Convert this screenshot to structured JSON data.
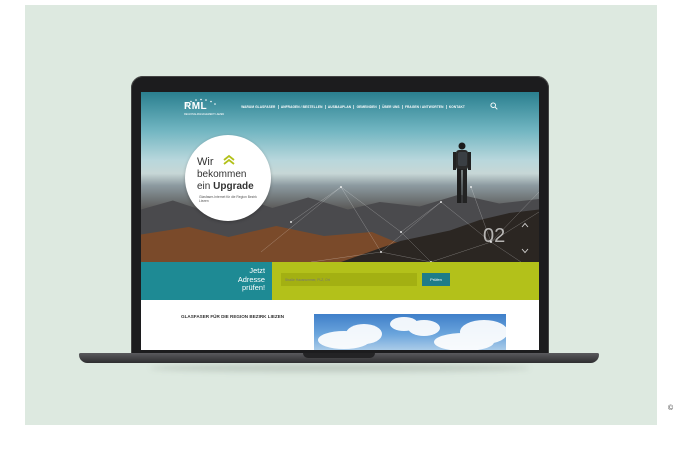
{
  "nav": {
    "logo_text": "RML",
    "logo_sub": "REGIONALMANAGEMENT LIEZEN",
    "items": [
      "WARUM GLASFASER",
      "ANFRAGEN / BESTELLEN",
      "AUSBAUPLAN",
      "GEMEINDEN",
      "ÜBER UNS",
      "FRAGEN / ANTWORTEN",
      "KONTAKT"
    ]
  },
  "hero": {
    "headline_line1": "Wir",
    "headline_line2": "bekommen",
    "headline_line3_prefix": "ein",
    "headline_line3_bold": "Upgrade",
    "subline": "Glasfaser-Internet für die Region Bezirk Liezen",
    "slide_counter": "02"
  },
  "address_check": {
    "label_line1": "Jetzt",
    "label_line2": "Adresse",
    "label_line3": "prüfen!",
    "input_placeholder": "Straße Hausnummer, PLZ, Ort",
    "button_label": "Prüfen"
  },
  "content": {
    "title": "GLASFASER FÜR DIE REGION BEZIRK LIEZEN"
  },
  "side_text": "©\n\n\n\n"
}
